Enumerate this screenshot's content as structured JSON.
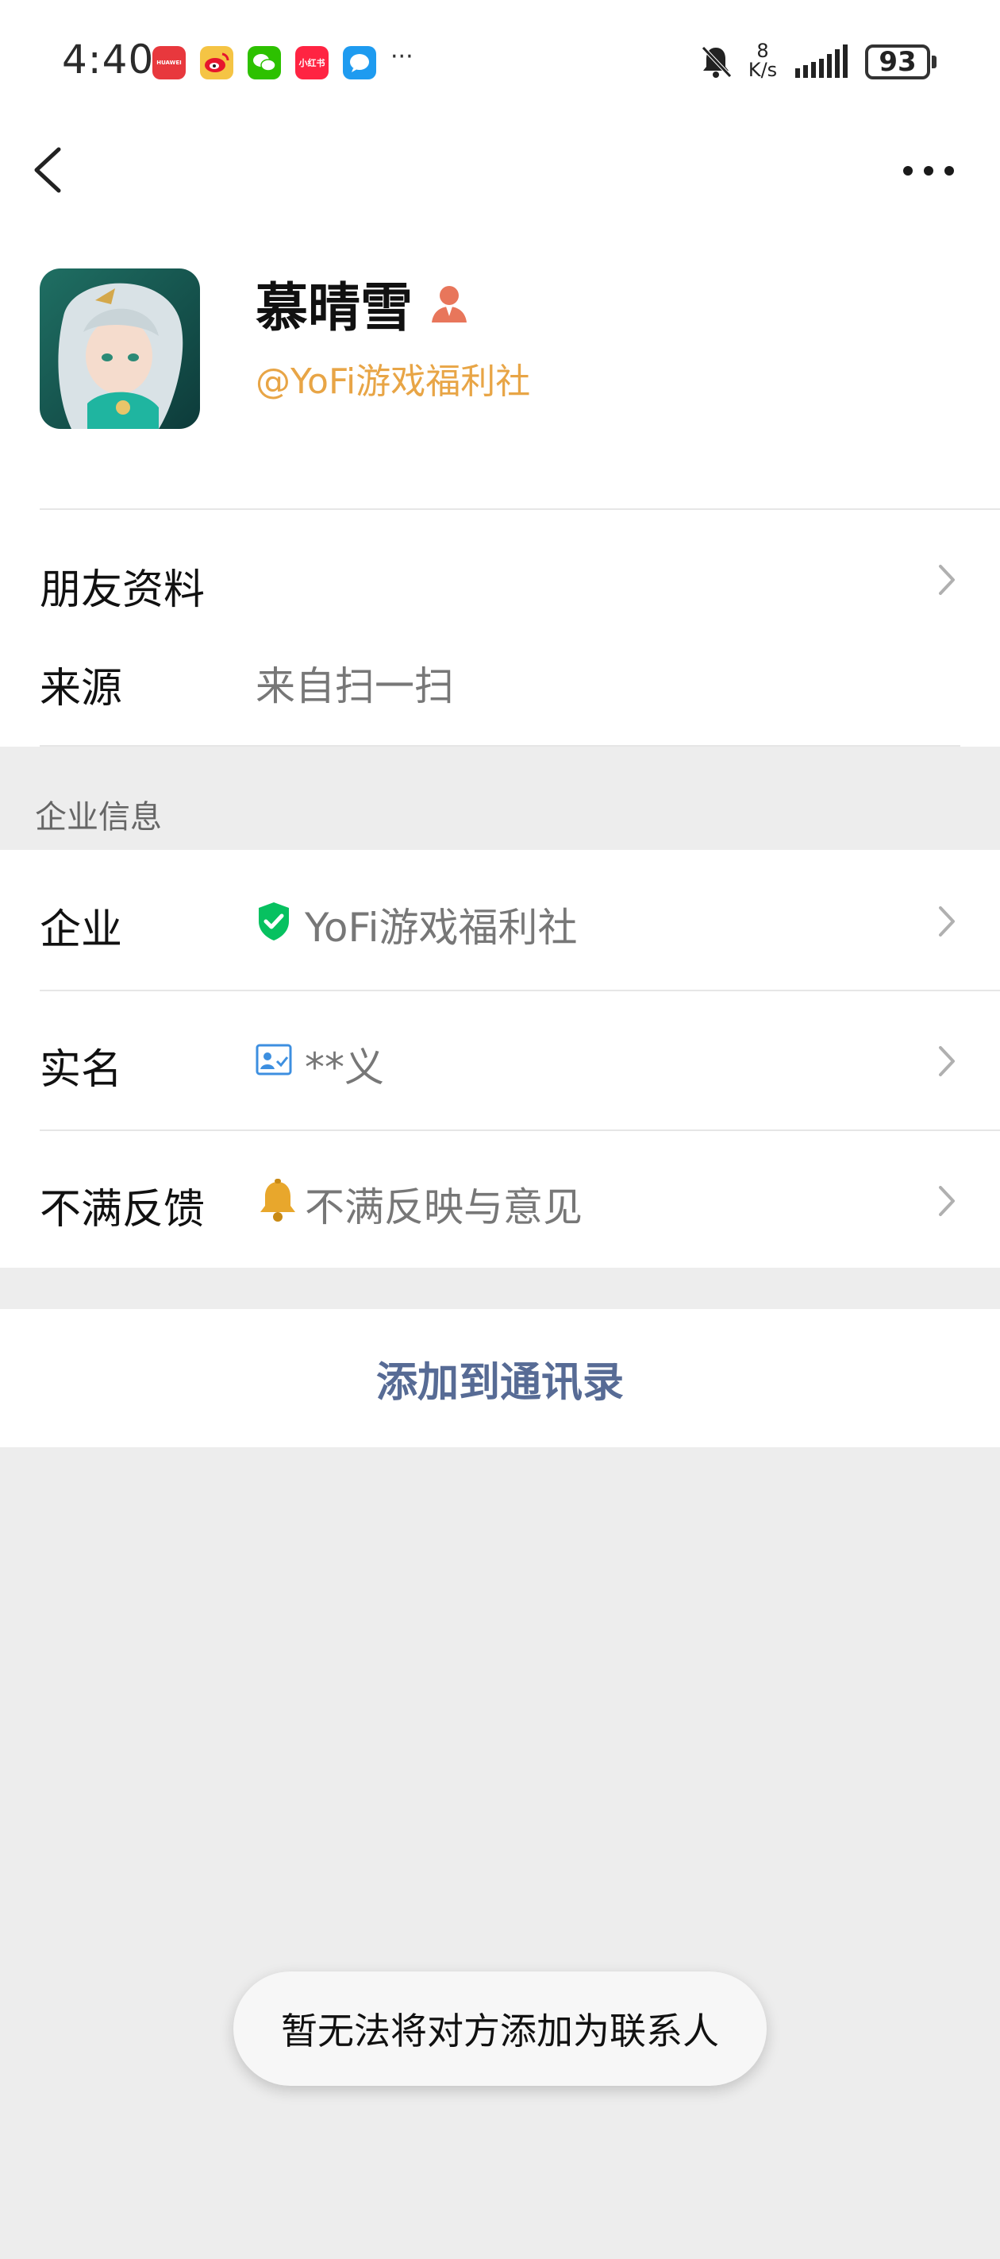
{
  "status_bar": {
    "time": "4:40",
    "net_speed_value": "8",
    "net_speed_unit": "K/s",
    "battery": "93",
    "more_indicator": "···",
    "apps": [
      {
        "name": "huawei-appgallery-icon",
        "label": "HUAWEI",
        "color": "#e8383d"
      },
      {
        "name": "weibo-icon",
        "label": "",
        "color": "#f5c444"
      },
      {
        "name": "wechat-icon",
        "label": "",
        "color": "#2dc100"
      },
      {
        "name": "xiaohongshu-icon",
        "label": "小红书",
        "color": "#ff2442"
      },
      {
        "name": "messages-icon",
        "label": "",
        "color": "#1e9bf0"
      }
    ]
  },
  "profile": {
    "name": "慕晴雪",
    "handle": "@YoFi游戏福利社",
    "handle_color": "#e8a546",
    "person_icon_color": "#e8765b"
  },
  "friend_info": {
    "title": "朋友资料",
    "source_label": "来源",
    "source_value": "来自扫一扫"
  },
  "enterprise_section": {
    "header": "企业信息",
    "rows": [
      {
        "label": "企业",
        "value": "YoFi游戏福利社",
        "icon": "verified-shield-icon"
      },
      {
        "label": "实名",
        "value": "**义",
        "icon": "id-card-icon"
      },
      {
        "label": "不满反馈",
        "value": "不满反映与意见",
        "icon": "bell-icon"
      }
    ]
  },
  "actions": {
    "add_to_contacts": "添加到通讯录"
  },
  "toast": {
    "message": "暂无法将对方添加为联系人"
  },
  "colors": {
    "link_blue": "#576b95",
    "verified_green": "#07c160",
    "page_bg": "#ededed"
  }
}
